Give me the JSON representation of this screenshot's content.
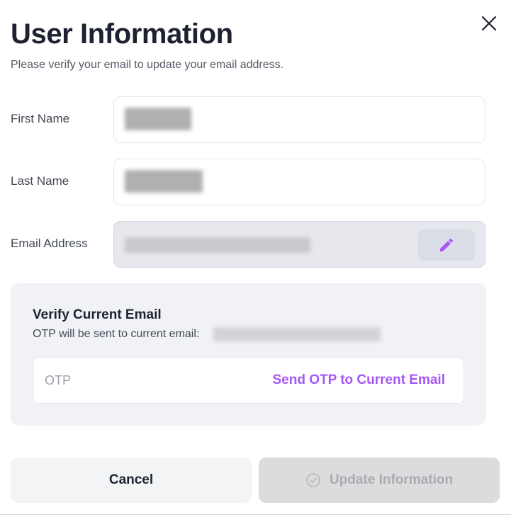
{
  "dialog": {
    "title": "User Information",
    "subtitle": "Please verify your email to update your email address.",
    "close_icon": "close-icon"
  },
  "fields": {
    "first_name": {
      "label": "First Name"
    },
    "last_name": {
      "label": "Last Name"
    },
    "email": {
      "label": "Email Address",
      "edit_icon": "pencil-icon"
    }
  },
  "verify": {
    "title": "Verify Current Email",
    "subtitle": "OTP will be sent to current email:",
    "otp_placeholder": "OTP",
    "send_label": "Send OTP to Current Email"
  },
  "actions": {
    "cancel_label": "Cancel",
    "update_label": "Update Information",
    "update_icon": "check-circle-icon"
  },
  "colors": {
    "accent": "#a855f7",
    "disabled_bg": "#dcdcdc",
    "panel_bg": "#f1f2f6"
  }
}
